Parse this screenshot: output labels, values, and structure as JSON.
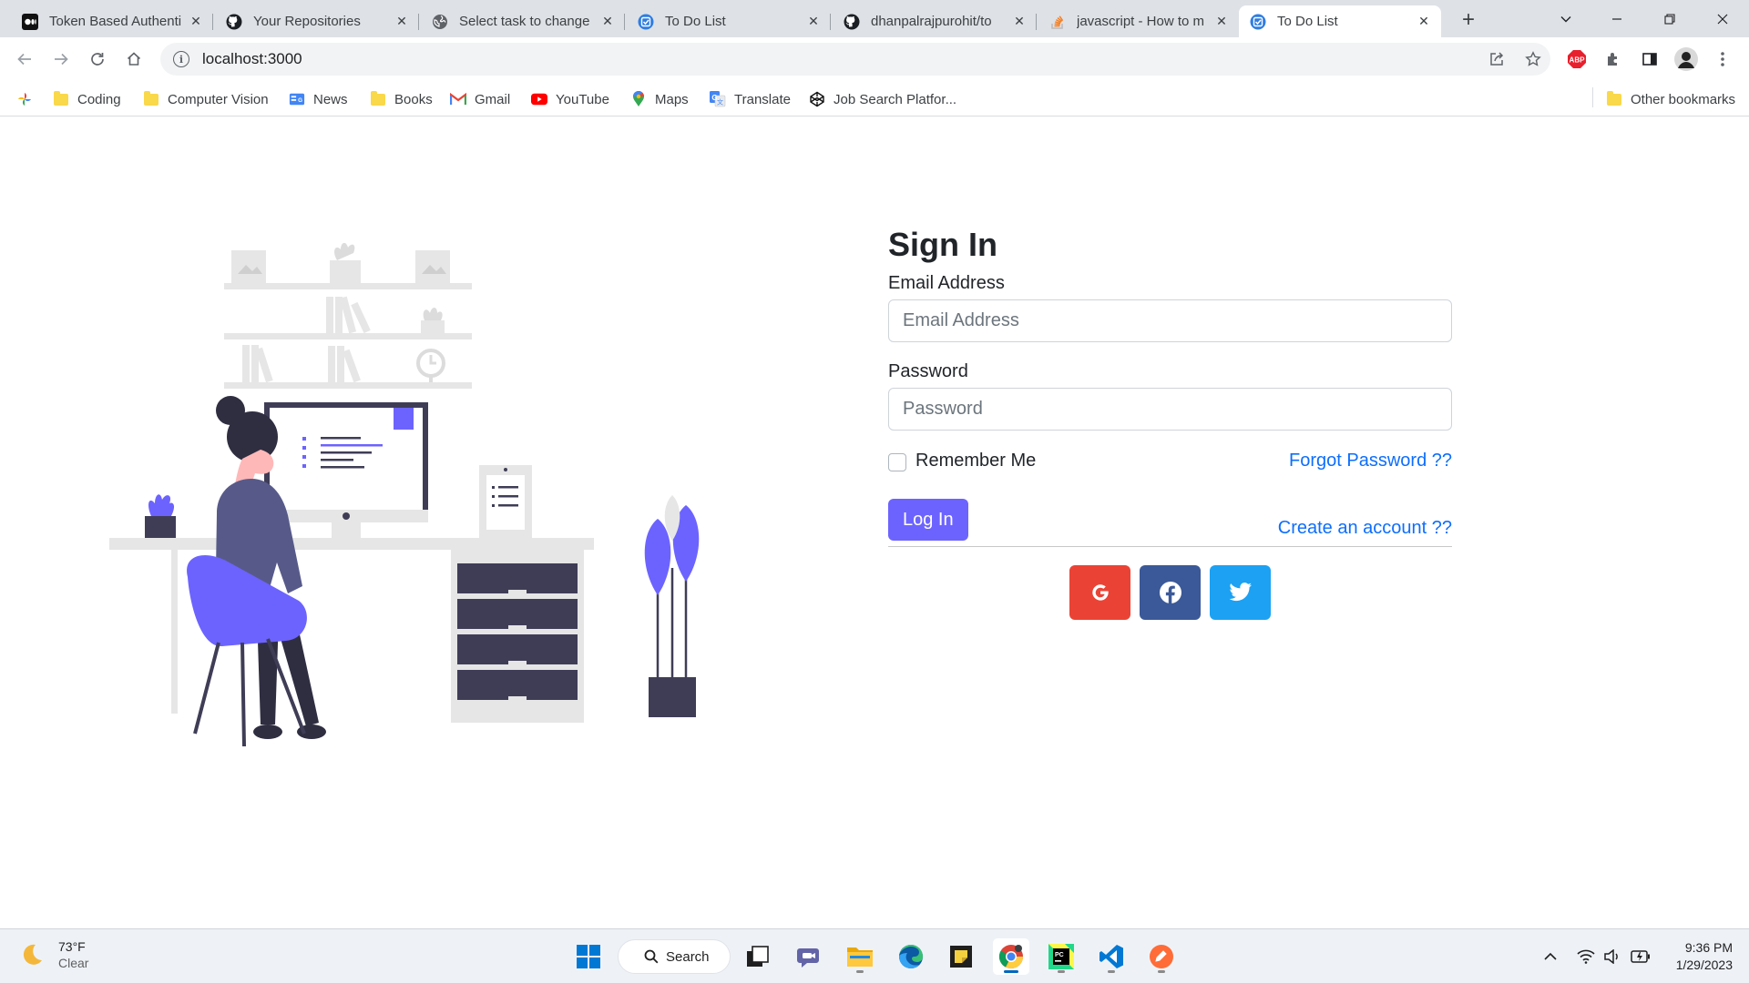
{
  "browser": {
    "tabs": [
      {
        "title": "Token Based Authenti",
        "favicon": "medium-icon"
      },
      {
        "title": "Your Repositories",
        "favicon": "github-icon"
      },
      {
        "title": "Select task to change",
        "favicon": "globe-icon"
      },
      {
        "title": "To Do List",
        "favicon": "todo-icon"
      },
      {
        "title": "dhanpalrajpurohit/to",
        "favicon": "github-icon"
      },
      {
        "title": "javascript - How to m",
        "favicon": "stackoverflow-icon"
      },
      {
        "title": "To Do List",
        "favicon": "todo-icon",
        "active": true
      }
    ],
    "url": "localhost:3000",
    "bookmarks": [
      {
        "label": "Coding",
        "icon": "folder-icon"
      },
      {
        "label": "Computer Vision",
        "icon": "folder-icon"
      },
      {
        "label": "News",
        "icon": "google-news-icon"
      },
      {
        "label": "Books",
        "icon": "folder-icon"
      },
      {
        "label": "Gmail",
        "icon": "gmail-icon"
      },
      {
        "label": "YouTube",
        "icon": "youtube-icon"
      },
      {
        "label": "Maps",
        "icon": "maps-icon"
      },
      {
        "label": "Translate",
        "icon": "translate-icon"
      },
      {
        "label": "Job Search Platfor...",
        "icon": "codepen-icon"
      }
    ],
    "other_bookmarks": "Other bookmarks"
  },
  "signin": {
    "title": "Sign In",
    "email_label": "Email Address",
    "email_placeholder": "Email Address",
    "password_label": "Password",
    "password_placeholder": "Password",
    "remember_label": "Remember Me",
    "forgot_link": "Forgot Password ??",
    "login_button": "Log In",
    "create_link": "Create an account ??",
    "social": [
      "google",
      "facebook",
      "twitter"
    ]
  },
  "colors": {
    "accent": "#6c63ff",
    "link": "#0d6efd",
    "google": "#ea4335",
    "facebook": "#3b5998",
    "twitter": "#1da1f2"
  },
  "taskbar": {
    "weather_temp": "73°F",
    "weather_cond": "Clear",
    "search_label": "Search",
    "time": "9:36 PM",
    "date": "1/29/2023",
    "apps": [
      "windows-start-icon",
      "task-view-icon",
      "teams-chat-icon",
      "file-explorer-icon",
      "edge-icon",
      "sticky-notes-icon",
      "chrome-icon",
      "pycharm-icon",
      "vscode-icon",
      "postman-icon"
    ]
  }
}
